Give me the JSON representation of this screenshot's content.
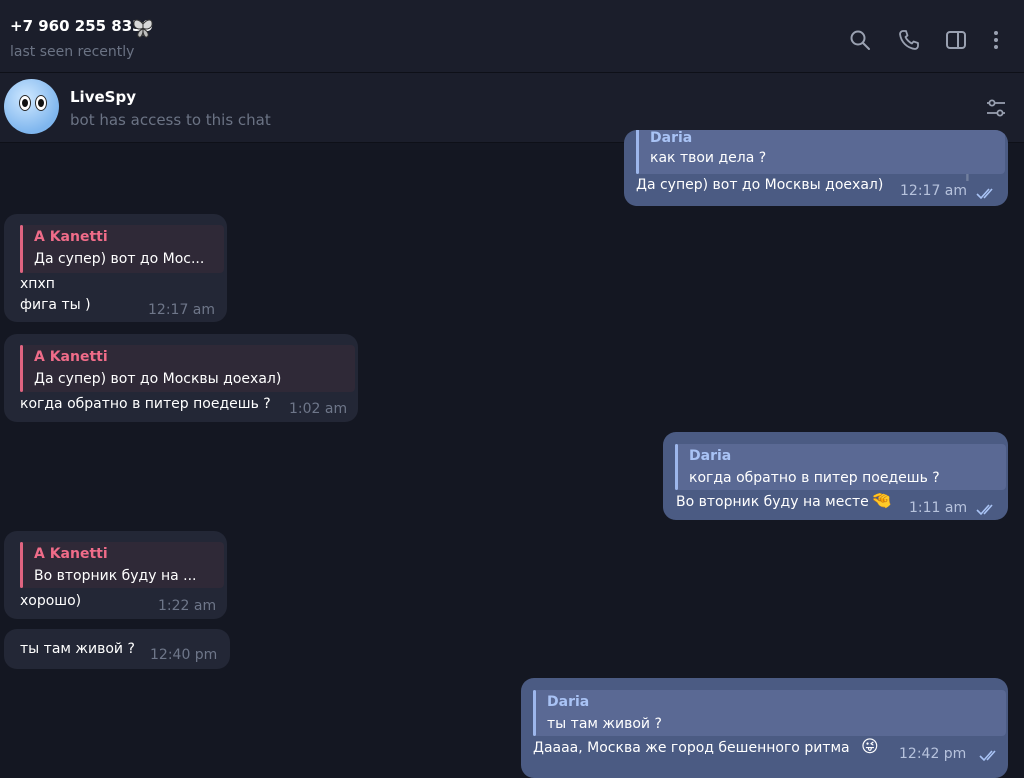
{
  "header": {
    "contact_name": "+7 960 255 8339",
    "status": "last seen recently"
  },
  "pinned_bot": {
    "name": "LiveSpy",
    "subtitle": "bot has access to this chat"
  },
  "messages": [
    {
      "dir": "out",
      "reply_name": "Daria",
      "reply_text": "как твои дела ?",
      "text": "Да супер) вот до Москвы доехал)",
      "time": "12:17 am",
      "read": true
    },
    {
      "dir": "in",
      "reply_name": "A Kanetti",
      "reply_text": "Да супер) вот до Мос...",
      "text_line1": "хпхп",
      "text": "фига ты )",
      "time": "12:17 am"
    },
    {
      "dir": "in",
      "reply_name": "A Kanetti",
      "reply_text": "Да супер) вот до Москвы доехал)",
      "text": "когда обратно в питер поедешь ?",
      "time": "1:02 am"
    },
    {
      "dir": "out",
      "reply_name": "Daria",
      "reply_text": "когда обратно в питер поедешь ?",
      "text": "Во вторник буду на месте",
      "emoji": "🤏",
      "time": "1:11 am",
      "read": true
    },
    {
      "dir": "in",
      "reply_name": "A Kanetti",
      "reply_text": "Во вторник буду на ...",
      "text": "хорошо)",
      "time": "1:22 am"
    },
    {
      "dir": "in",
      "text": "ты там живой ?",
      "time": "12:40 pm"
    },
    {
      "dir": "out",
      "reply_name": "Daria",
      "reply_text": "ты там живой ?",
      "text": "Даааа, Москва же город бешенного ритма",
      "emoji": "😜",
      "time": "12:42 pm",
      "read": true
    }
  ],
  "colors": {
    "background": "#141722",
    "header": "#1b1e2b",
    "incoming_bubble": "#232736",
    "outgoing_bubble": "#4b5b83",
    "reply_name_incoming": "#f06c89",
    "reply_name_outgoing": "#a9c3f5"
  },
  "icons": [
    "search-icon",
    "phone-icon",
    "sidebar-toggle-icon",
    "more-vertical-icon",
    "filter-settings-icon",
    "double-check-icon",
    "butterfly-emoji-icon"
  ]
}
